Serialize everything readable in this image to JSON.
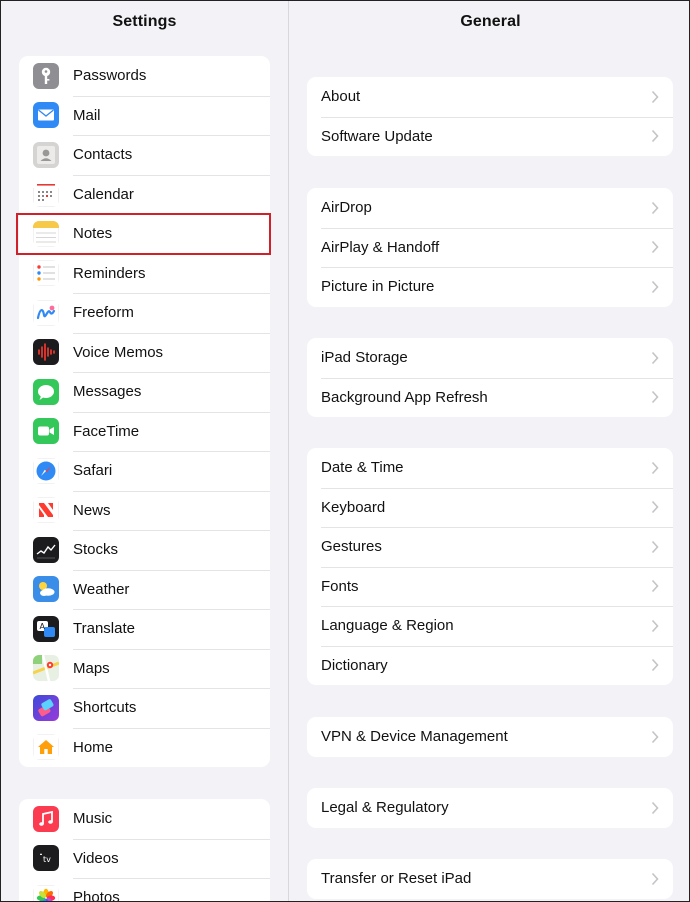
{
  "sidebar": {
    "title": "Settings",
    "groups": [
      {
        "items": [
          {
            "label": "Passwords",
            "icon": "key-icon"
          },
          {
            "label": "Mail",
            "icon": "mail-icon"
          },
          {
            "label": "Contacts",
            "icon": "contacts-icon"
          },
          {
            "label": "Calendar",
            "icon": "calendar-icon"
          },
          {
            "label": "Notes",
            "icon": "notes-icon"
          },
          {
            "label": "Reminders",
            "icon": "reminders-icon"
          },
          {
            "label": "Freeform",
            "icon": "freeform-icon"
          },
          {
            "label": "Voice Memos",
            "icon": "voice-memos-icon"
          },
          {
            "label": "Messages",
            "icon": "messages-icon"
          },
          {
            "label": "FaceTime",
            "icon": "facetime-icon"
          },
          {
            "label": "Safari",
            "icon": "safari-icon"
          },
          {
            "label": "News",
            "icon": "news-icon"
          },
          {
            "label": "Stocks",
            "icon": "stocks-icon"
          },
          {
            "label": "Weather",
            "icon": "weather-icon"
          },
          {
            "label": "Translate",
            "icon": "translate-icon"
          },
          {
            "label": "Maps",
            "icon": "maps-icon"
          },
          {
            "label": "Shortcuts",
            "icon": "shortcuts-icon"
          },
          {
            "label": "Home",
            "icon": "home-icon"
          }
        ]
      },
      {
        "items": [
          {
            "label": "Music",
            "icon": "music-icon"
          },
          {
            "label": "Videos",
            "icon": "tv-icon"
          },
          {
            "label": "Photos",
            "icon": "photos-icon"
          }
        ]
      }
    ],
    "selected": "Notes",
    "highlight_color": "#d0202a"
  },
  "detail": {
    "title": "General",
    "groups": [
      {
        "items": [
          "About",
          "Software Update"
        ]
      },
      {
        "items": [
          "AirDrop",
          "AirPlay & Handoff",
          "Picture in Picture"
        ]
      },
      {
        "items": [
          "iPad Storage",
          "Background App Refresh"
        ]
      },
      {
        "items": [
          "Date & Time",
          "Keyboard",
          "Gestures",
          "Fonts",
          "Language & Region",
          "Dictionary"
        ]
      },
      {
        "items": [
          "VPN & Device Management"
        ]
      },
      {
        "items": [
          "Legal & Regulatory"
        ]
      },
      {
        "items": [
          "Transfer or Reset iPad"
        ]
      }
    ]
  }
}
